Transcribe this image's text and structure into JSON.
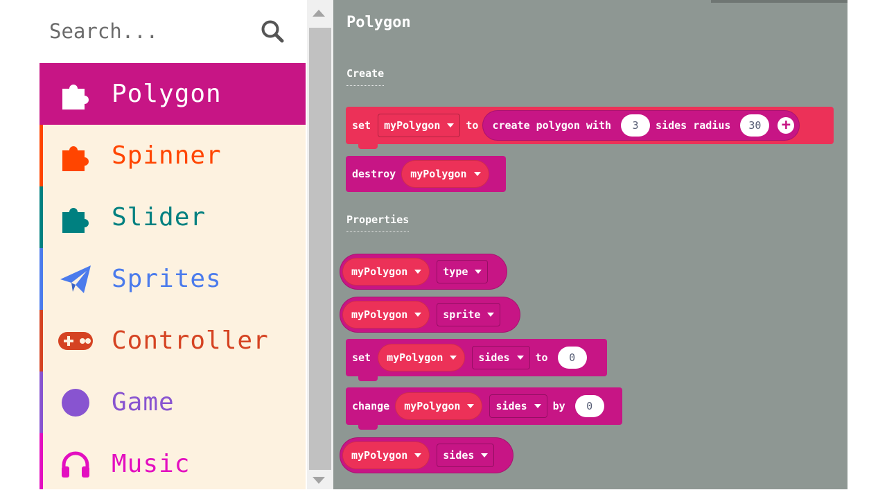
{
  "search": {
    "placeholder": "Search..."
  },
  "categories": [
    {
      "label": "Polygon",
      "icon": "puzzle-icon",
      "color": "#c71585",
      "selected": true
    },
    {
      "label": "Spinner",
      "icon": "puzzle-icon",
      "color": "#ff4500",
      "selected": false
    },
    {
      "label": "Slider",
      "icon": "puzzle-icon",
      "color": "#008080",
      "selected": false
    },
    {
      "label": "Sprites",
      "icon": "paper-plane-icon",
      "color": "#4b7bec",
      "selected": false
    },
    {
      "label": "Controller",
      "icon": "gamepad-icon",
      "color": "#d54322",
      "selected": false
    },
    {
      "label": "Game",
      "icon": "circle-icon",
      "color": "#8854d0",
      "selected": false
    },
    {
      "label": "Music",
      "icon": "headphones-icon",
      "color": "#e30fc0",
      "selected": false
    }
  ],
  "flyout": {
    "title": "Polygon",
    "sections": {
      "create": "Create",
      "properties": "Properties"
    },
    "blocks": {
      "create_polygon": {
        "set": "set",
        "var": "myPolygon",
        "to": "to",
        "text1": "create polygon with",
        "sides": "3",
        "text2": "sides radius",
        "radius": "30"
      },
      "destroy": {
        "keyword": "destroy",
        "var": "myPolygon"
      },
      "prop_type": {
        "var": "myPolygon",
        "prop": "type"
      },
      "prop_sprite": {
        "var": "myPolygon",
        "prop": "sprite"
      },
      "set_prop": {
        "set": "set",
        "var": "myPolygon",
        "prop": "sides",
        "to": "to",
        "value": "0"
      },
      "change_prop": {
        "change": "change",
        "var": "myPolygon",
        "prop": "sides",
        "by": "by",
        "value": "0"
      },
      "prop_sides": {
        "var": "myPolygon",
        "prop": "sides"
      }
    }
  },
  "colors": {
    "block_magenta": "#c71585",
    "block_red": "#ec3158",
    "flyout_bg": "#8e9793",
    "toolbox_bg": "#fdf2e0"
  }
}
